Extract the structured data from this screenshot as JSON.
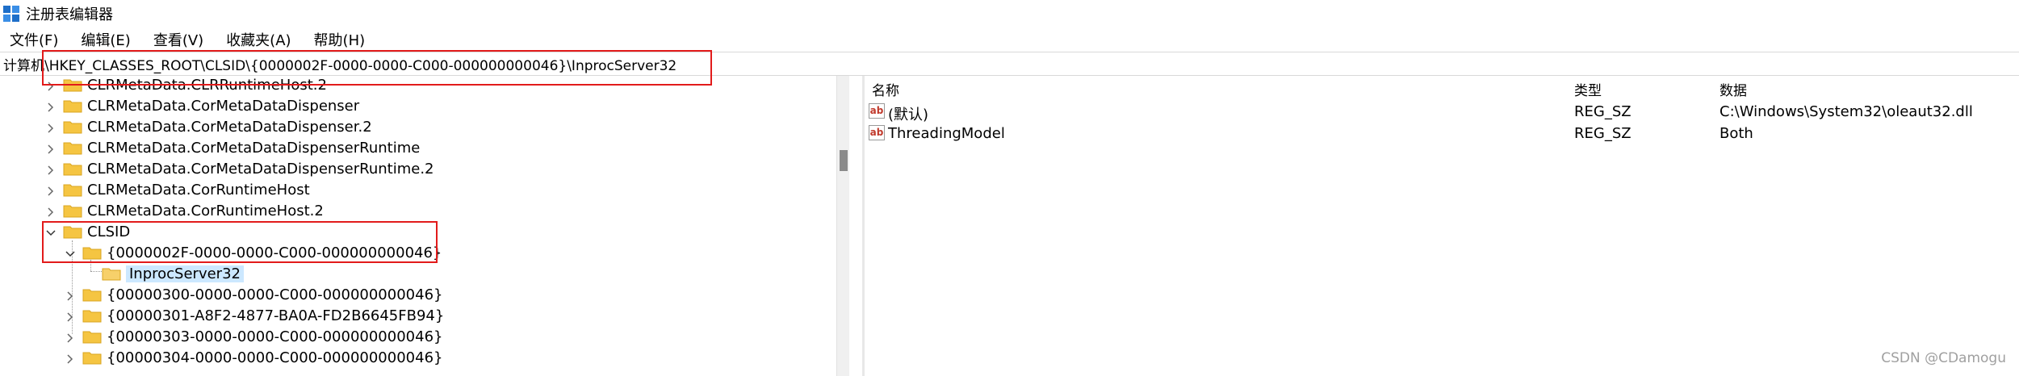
{
  "window": {
    "title": "注册表编辑器"
  },
  "menu": [
    "文件(F)",
    "编辑(E)",
    "查看(V)",
    "收藏夹(A)",
    "帮助(H)"
  ],
  "address": {
    "path": "计算机\\HKEY_CLASSES_ROOT\\CLSID\\{0000002F-0000-0000-C000-000000000046}\\InprocServer32"
  },
  "tree": {
    "items": [
      {
        "label": "CLRMetaData.CLRRuntimeHost.2",
        "level": 0,
        "expanded": false
      },
      {
        "label": "CLRMetaData.CorMetaDataDispenser",
        "level": 0,
        "expanded": false
      },
      {
        "label": "CLRMetaData.CorMetaDataDispenser.2",
        "level": 0,
        "expanded": false
      },
      {
        "label": "CLRMetaData.CorMetaDataDispenserRuntime",
        "level": 0,
        "expanded": false
      },
      {
        "label": "CLRMetaData.CorMetaDataDispenserRuntime.2",
        "level": 0,
        "expanded": false
      },
      {
        "label": "CLRMetaData.CorRuntimeHost",
        "level": 0,
        "expanded": false
      },
      {
        "label": "CLRMetaData.CorRuntimeHost.2",
        "level": 0,
        "expanded": false
      },
      {
        "label": "CLSID",
        "level": 0,
        "expanded": true
      },
      {
        "label": "{0000002F-0000-0000-C000-000000000046}",
        "level": 1,
        "expanded": true
      },
      {
        "label": "InprocServer32",
        "level": 2,
        "selected": true
      },
      {
        "label": "{00000300-0000-0000-C000-000000000046}",
        "level": 1,
        "expanded": false
      },
      {
        "label": "{00000301-A8F2-4877-BA0A-FD2B6645FB94}",
        "level": 1,
        "expanded": false
      },
      {
        "label": "{00000303-0000-0000-C000-000000000046}",
        "level": 1,
        "expanded": false
      },
      {
        "label": "{00000304-0000-0000-C000-000000000046}",
        "level": 1,
        "expanded": false
      }
    ]
  },
  "list": {
    "columns": {
      "name": "名称",
      "type": "类型",
      "data": "数据"
    },
    "rows": [
      {
        "name": "(默认)",
        "type": "REG_SZ",
        "data": "C:\\Windows\\System32\\oleaut32.dll"
      },
      {
        "name": "ThreadingModel",
        "type": "REG_SZ",
        "data": "Both"
      }
    ]
  },
  "watermark": "CSDN @CDamogu",
  "colors": {
    "highlight": "#e21b1b",
    "selection": "#cce8ff",
    "folder": "#f5c542"
  },
  "icons": {
    "app": "registry-editor-icon",
    "folder": "folder-icon",
    "string_value": "ab-string-icon"
  }
}
